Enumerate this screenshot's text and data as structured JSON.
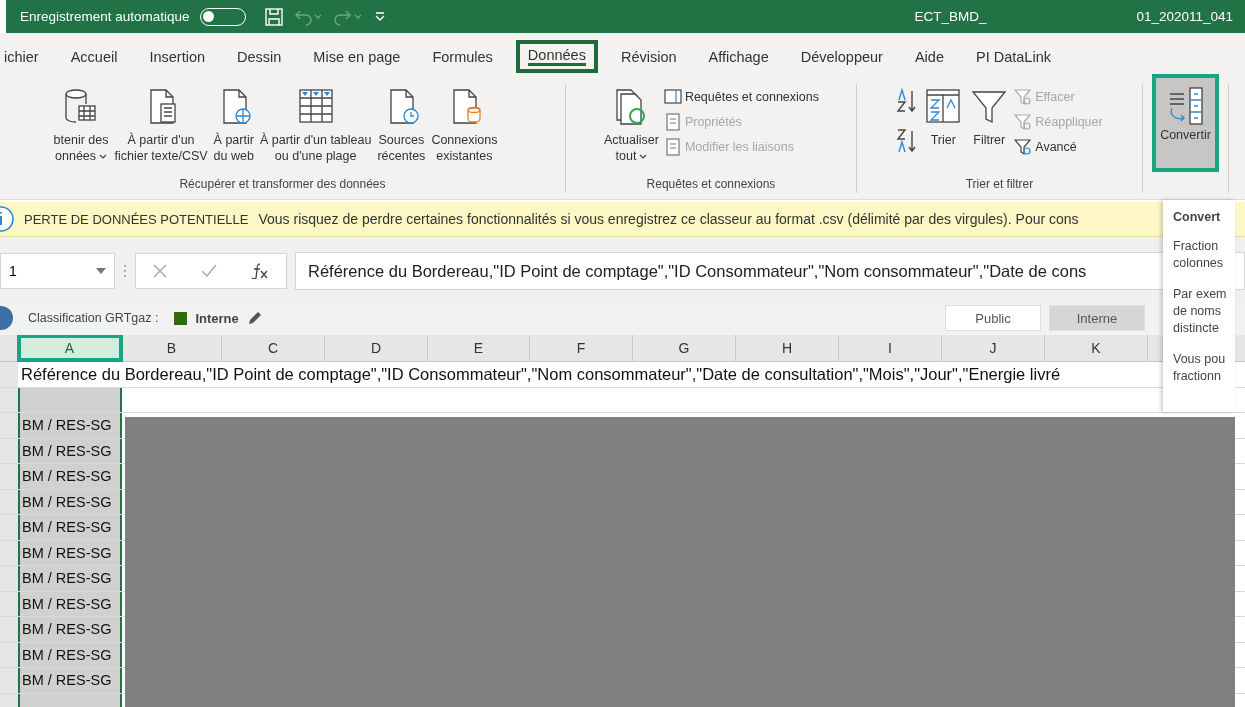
{
  "title_bar": {
    "autosave_label": "Enregistrement automatique",
    "autosave_on": false,
    "file_name": "ECT_BMD_",
    "file_suffix": "01_202011_041"
  },
  "tabs": [
    {
      "label": "ichier",
      "selected": false
    },
    {
      "label": "Accueil",
      "selected": false
    },
    {
      "label": "Insertion",
      "selected": false
    },
    {
      "label": "Dessin",
      "selected": false
    },
    {
      "label": "Mise en page",
      "selected": false
    },
    {
      "label": "Formules",
      "selected": false
    },
    {
      "label": "Données",
      "selected": true
    },
    {
      "label": "Révision",
      "selected": false
    },
    {
      "label": "Affichage",
      "selected": false
    },
    {
      "label": "Développeur",
      "selected": false
    },
    {
      "label": "Aide",
      "selected": false
    },
    {
      "label": "PI DataLink",
      "selected": false
    }
  ],
  "ribbon": {
    "groups": [
      {
        "label": "Récupérer et transformer des données",
        "items": [
          {
            "kind": "large",
            "lines": [
              "btenir des",
              "onnées"
            ],
            "dropdown": true
          },
          {
            "kind": "large",
            "lines": [
              "À partir d'un",
              "fichier texte/CSV"
            ],
            "dropdown": false
          },
          {
            "kind": "large",
            "lines": [
              "À partir",
              "du web"
            ],
            "dropdown": false
          },
          {
            "kind": "large",
            "lines": [
              "À partir d'un tableau",
              "ou d'une plage"
            ],
            "dropdown": false
          },
          {
            "kind": "large",
            "lines": [
              "Sources",
              "récentes"
            ],
            "dropdown": false
          },
          {
            "kind": "large",
            "lines": [
              "Connexions",
              "existantes"
            ],
            "dropdown": false
          }
        ]
      },
      {
        "label": "Requêtes et connexions",
        "items": [
          {
            "kind": "large",
            "lines": [
              "Actualiser",
              "tout"
            ],
            "dropdown": true
          },
          {
            "kind": "stack",
            "entries": [
              {
                "label": "Requêtes et connexions",
                "disabled": false
              },
              {
                "label": "Propriétés",
                "disabled": true
              },
              {
                "label": "Modifier les liaisons",
                "disabled": true
              }
            ]
          }
        ]
      },
      {
        "label": "Trier et filtrer",
        "items": [
          {
            "kind": "sort"
          },
          {
            "kind": "medium",
            "lines": [
              "Trier"
            ],
            "dropdown": false
          },
          {
            "kind": "medium",
            "lines": [
              "Filtrer"
            ],
            "dropdown": false
          },
          {
            "kind": "stack",
            "entries": [
              {
                "label": "Effacer",
                "disabled": true
              },
              {
                "label": "Réappliquer",
                "disabled": true
              },
              {
                "label": "Avancé",
                "disabled": false
              }
            ]
          }
        ]
      },
      {
        "items": [
          {
            "kind": "highlight",
            "lines": [
              "Convertir"
            ],
            "dropdown": false
          }
        ]
      }
    ]
  },
  "info_bar": {
    "title": "PERTE DE DONNÉES POTENTIELLE",
    "message": "Vous risquez de perdre certaines fonctionnalités si vous enregistrez ce classeur au format .csv (délimité par des virgules). Pour cons"
  },
  "formula_bar": {
    "name_box": "1",
    "formula": "Référence du Bordereau,\"ID Point de comptage\",\"ID Consommateur\",\"Nom consommateur\",\"Date de cons"
  },
  "classification": {
    "label": "Classification GRTgaz :",
    "value": "Interne",
    "color": "#2f6b0f",
    "options": [
      {
        "label": "Public",
        "selected": false
      },
      {
        "label": "Interne",
        "selected": true
      }
    ]
  },
  "columns": [
    {
      "label": "A",
      "selected": true
    },
    {
      "label": "B",
      "selected": false
    },
    {
      "label": "C",
      "selected": false
    },
    {
      "label": "D",
      "selected": false
    },
    {
      "label": "E",
      "selected": false
    },
    {
      "label": "F",
      "selected": false
    },
    {
      "label": "G",
      "selected": false
    },
    {
      "label": "H",
      "selected": false
    },
    {
      "label": "I",
      "selected": false
    },
    {
      "label": "J",
      "selected": false
    },
    {
      "label": "K",
      "selected": false
    }
  ],
  "rows": [
    "Référence du Bordereau,\"ID Point de comptage\",\"ID Consommateur\",\"Nom consommateur\",\"Date de consultation\",\"Mois\",\"Jour\",\"Energie livré",
    "",
    "BM / RES-SG",
    "BM / RES-SG",
    "BM / RES-SG",
    "BM / RES-SG",
    "BM / RES-SG",
    "BM / RES-SG",
    "BM / RES-SG",
    "BM / RES-SG",
    "BM / RES-SG",
    "BM / RES-SG",
    "BM / RES-SG"
  ],
  "tooltip": {
    "title": "Convert",
    "paragraphs": [
      [
        "Fraction",
        "colonnes"
      ],
      [
        "Par exem",
        "de noms",
        "distincte"
      ],
      [
        "Vous pou",
        "fractionn"
      ]
    ]
  }
}
